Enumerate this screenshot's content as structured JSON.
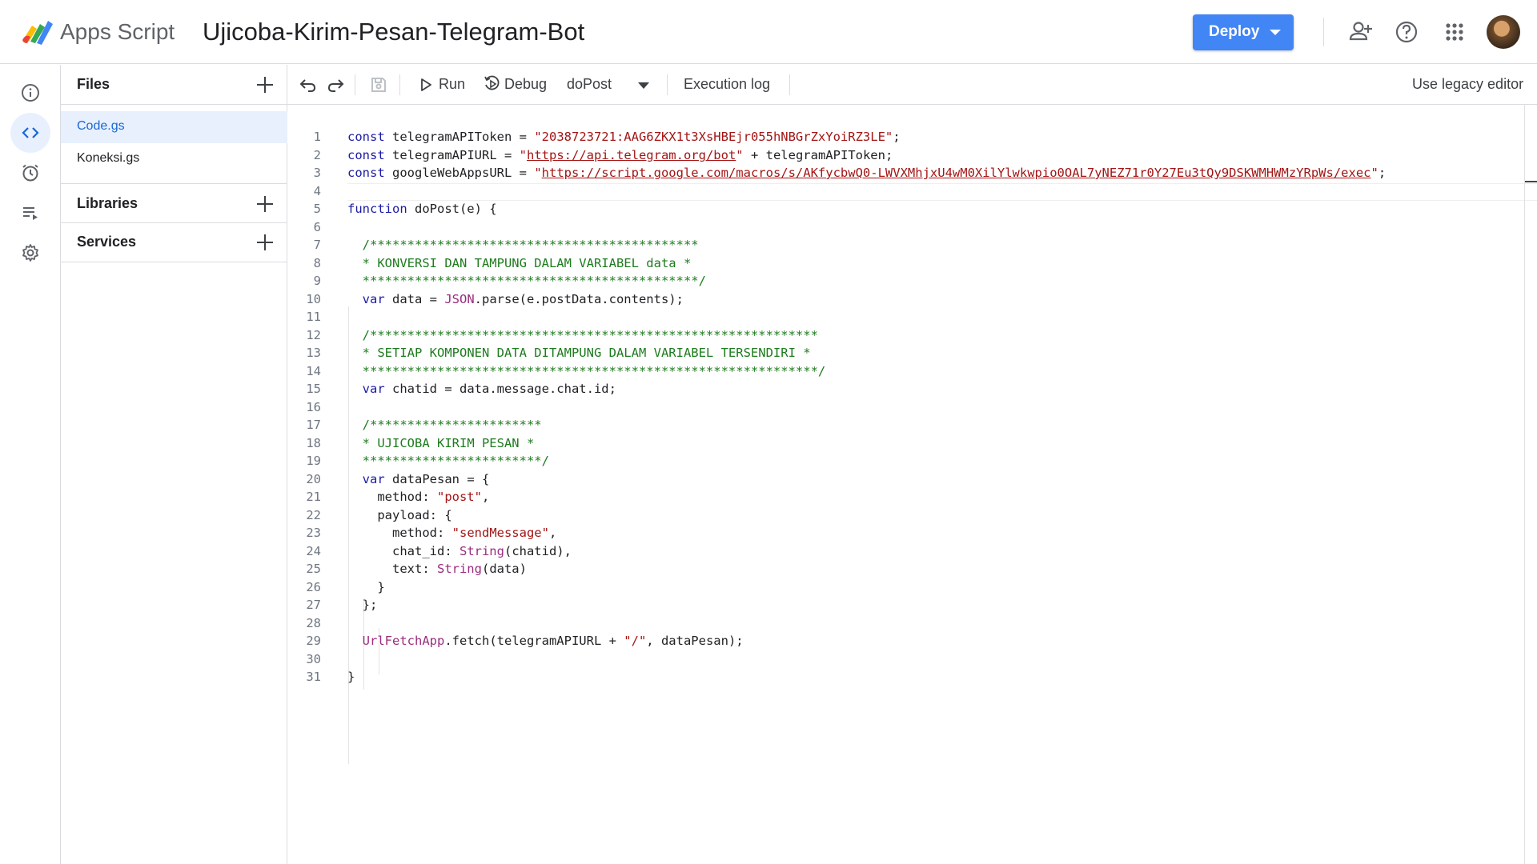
{
  "header": {
    "app_name": "Apps Script",
    "project_title": "Ujicoba-Kirim-Pesan-Telegram-Bot",
    "deploy_label": "Deploy",
    "icons": [
      "add-person-icon",
      "help-icon",
      "apps-grid-icon"
    ],
    "colors": {
      "deploy": "#4285f4"
    }
  },
  "rail": {
    "items": [
      "overview-icon",
      "editor-icon",
      "triggers-icon",
      "executions-icon",
      "settings-icon"
    ]
  },
  "sidebar": {
    "files_label": "Files",
    "files": [
      "Code.gs",
      "Koneksi.gs"
    ],
    "libraries_label": "Libraries",
    "services_label": "Services"
  },
  "toolbar": {
    "run_label": "Run",
    "debug_label": "Debug",
    "function_selected": "doPost",
    "execution_log_label": "Execution log",
    "legacy_label": "Use legacy editor"
  },
  "code": {
    "line_numbers": [
      "1",
      "2",
      "3",
      "4",
      "5",
      "6",
      "7",
      "8",
      "9",
      "10",
      "11",
      "12",
      "13",
      "14",
      "15",
      "16",
      "17",
      "18",
      "19",
      "20",
      "21",
      "22",
      "23",
      "24",
      "25",
      "26",
      "27",
      "28",
      "29",
      "30",
      "31"
    ],
    "token": "2038723721:AAG6ZKX1t3XsHBEjr055hNBGrZxYoiRZ3LE",
    "api_url": "https://api.telegram.org/bot",
    "webapp_url": "https://script.google.com/macros/s/AKfycbwQ0-LWVXMhjxU4wM0XilYlwkwpio0OAL7yNEZ71r0Y27Eu3tQy9DSKWMHWMzYRpWs/exec",
    "comment_stars_1": "/********************************************",
    "comment_text_1": "* KONVERSI DAN TAMPUNG DALAM VARIABEL data *",
    "comment_end_1": "*********************************************/",
    "comment_stars_2": "/************************************************************",
    "comment_text_2": "* SETIAP KOMPONEN DATA DITAMPUNG DALAM VARIABEL TERSENDIRI *",
    "comment_end_2": "*************************************************************/",
    "comment_stars_3": "/***********************",
    "comment_text_3": "* UJICOBA KIRIM PESAN *",
    "comment_end_3": "************************/",
    "str_post": "\"post\"",
    "str_send": "\"sendMessage\"",
    "str_slash": "\"/\""
  }
}
